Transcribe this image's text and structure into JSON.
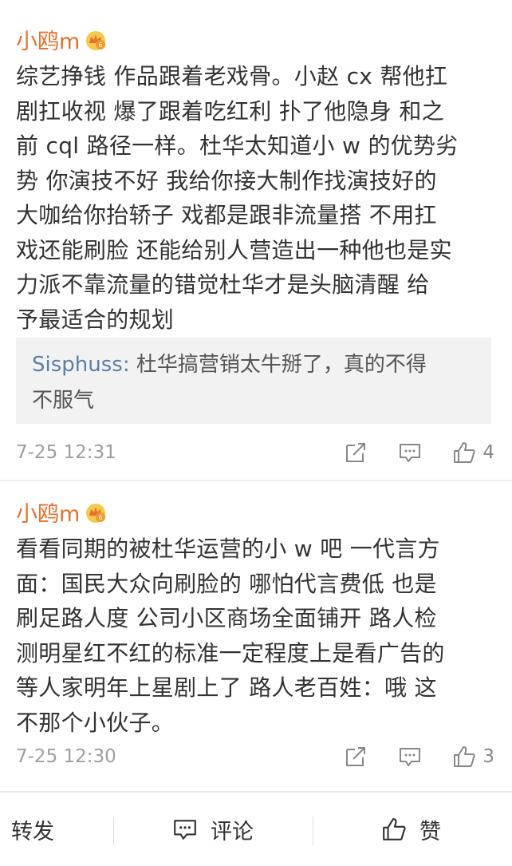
{
  "comments": [
    {
      "username": "小鸥m",
      "badge_icon": "crown-badge-icon",
      "lines": [
        "综艺挣钱 作品跟着老戏骨。小赵 cx 帮他扛",
        "剧扛收视 爆了跟着吃红利 扑了他隐身 和之",
        "前 cql 路径一样。杜华太知道小 w 的优势劣",
        "势 你演技不好 我给你接大制作找演技好的",
        "大咖给你抬轿子 戏都是跟非流量搭 不用扛",
        "戏还能刷脸 还能给别人营造出一种他也是实",
        "力派不靠流量的错觉杜华才是头脑清醒  给",
        "予最适合的规划"
      ],
      "reply": {
        "author": "Sisphuss:",
        "line1": " 杜华搞营销太牛掰了，真的不得",
        "line2": "不服气"
      },
      "timestamp": "7-25 12:31",
      "like_count": "4"
    },
    {
      "username": "小鸥m",
      "badge_icon": "crown-badge-icon",
      "lines": [
        "看看同期的被杜华运营的小 w 吧  一代言方",
        "面：国民大众向刷脸的 哪怕代言费低 也是",
        "刷足路人度 公司小区商场全面铺开 路人检",
        "测明星红不红的标准一定程度上是看广告的",
        "等人家明年上星剧上了 路人老百姓：哦 这",
        "不那个小伙子。"
      ],
      "timestamp": "7-25 12:30",
      "like_count": "3"
    }
  ],
  "bottom_bar": {
    "repost_label": "转发",
    "comment_label": "评论",
    "like_label": "赞"
  },
  "colors": {
    "username": "#e8702a",
    "reply_author": "#5b7fa8",
    "reply_bg": "#f2f2f2",
    "timestamp": "#9e9e9e"
  }
}
